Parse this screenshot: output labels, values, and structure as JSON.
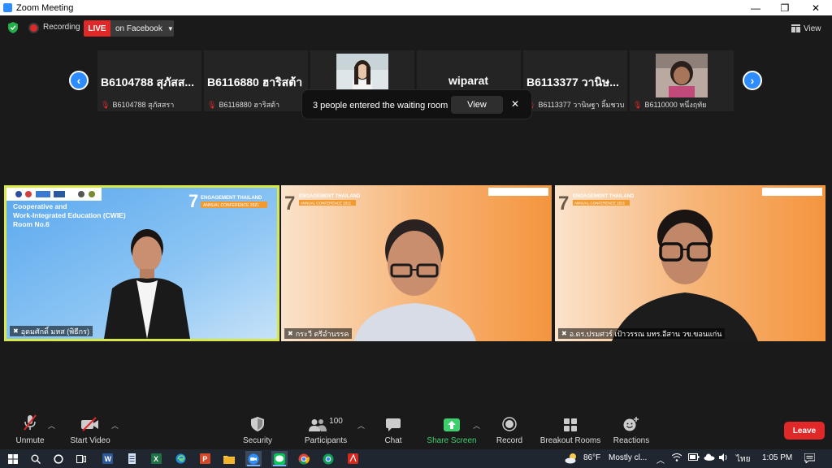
{
  "window": {
    "title": "Zoom Meeting",
    "minimize": "—",
    "maximize": "❐",
    "close": "✕"
  },
  "topbar": {
    "recording_label": "Recording",
    "live_label": "LIVE",
    "stream_target": "on Facebook",
    "view_label": "View"
  },
  "strip": {
    "prev": "‹",
    "next": "›",
    "thumbs": [
      {
        "big": "B6104788 สุภัสส...",
        "small": "B6104788 สุภัสสรา",
        "photo": false
      },
      {
        "big": "B6116880 ฮาริสต้า",
        "small": "B6116880 ฮาริสต้า",
        "photo": false
      },
      {
        "big": "",
        "small": "",
        "photo": true
      },
      {
        "big": "wiparat",
        "small": "",
        "photo": false
      },
      {
        "big": "B6113377 วานิษ...",
        "small": "B6113377 วานิษฐา ลิ้มชวบ",
        "photo": false
      },
      {
        "big": "",
        "small": "B6110000 หนึ่งฤทัย",
        "photo": true
      }
    ]
  },
  "toast": {
    "message": "3 people entered the waiting room",
    "view_label": "View",
    "close": "✕"
  },
  "tiles": [
    {
      "name": "อุดมศักดิ์ มหส (พิธีกร)",
      "banner_title": "Cooperative and Work-Integrated Education (CWIE) Room No.6",
      "conf_number": "7",
      "conf_line1": "ENGAGEMENT THAILAND",
      "conf_line2": "ANNUAL CONFERENCE 2021"
    },
    {
      "name": "กระวี ตรีอำนรรค",
      "conf_number": "7",
      "conf_line1": "ENGAGEMENT THAILAND",
      "conf_line2": "ANNUAL CONFERENCE 2021"
    },
    {
      "name": "อ.ดร.ปรมศวร์ เป้าวรรณ มทร.อีสาน วข.ขอนแก่น",
      "conf_number": "7",
      "conf_line1": "ENGAGEMENT THAILAND",
      "conf_line2": "ANNUAL CONFERENCE 2021"
    }
  ],
  "toolbar": {
    "unmute": "Unmute",
    "start_video": "Start Video",
    "security": "Security",
    "participants": "Participants",
    "participants_count": "100",
    "chat": "Chat",
    "share_screen": "Share Screen",
    "record": "Record",
    "breakout_rooms": "Breakout Rooms",
    "reactions": "Reactions",
    "leave": "Leave"
  },
  "taskbar": {
    "weather_temp": "86°F",
    "weather_desc": "Mostly cl...",
    "language": "ไทย",
    "time": "1:05 PM"
  },
  "colors": {
    "accent": "#2d8cff",
    "live_red": "#e02828",
    "share_green": "#3ccf6e",
    "active_speaker": "#d8e84a"
  }
}
